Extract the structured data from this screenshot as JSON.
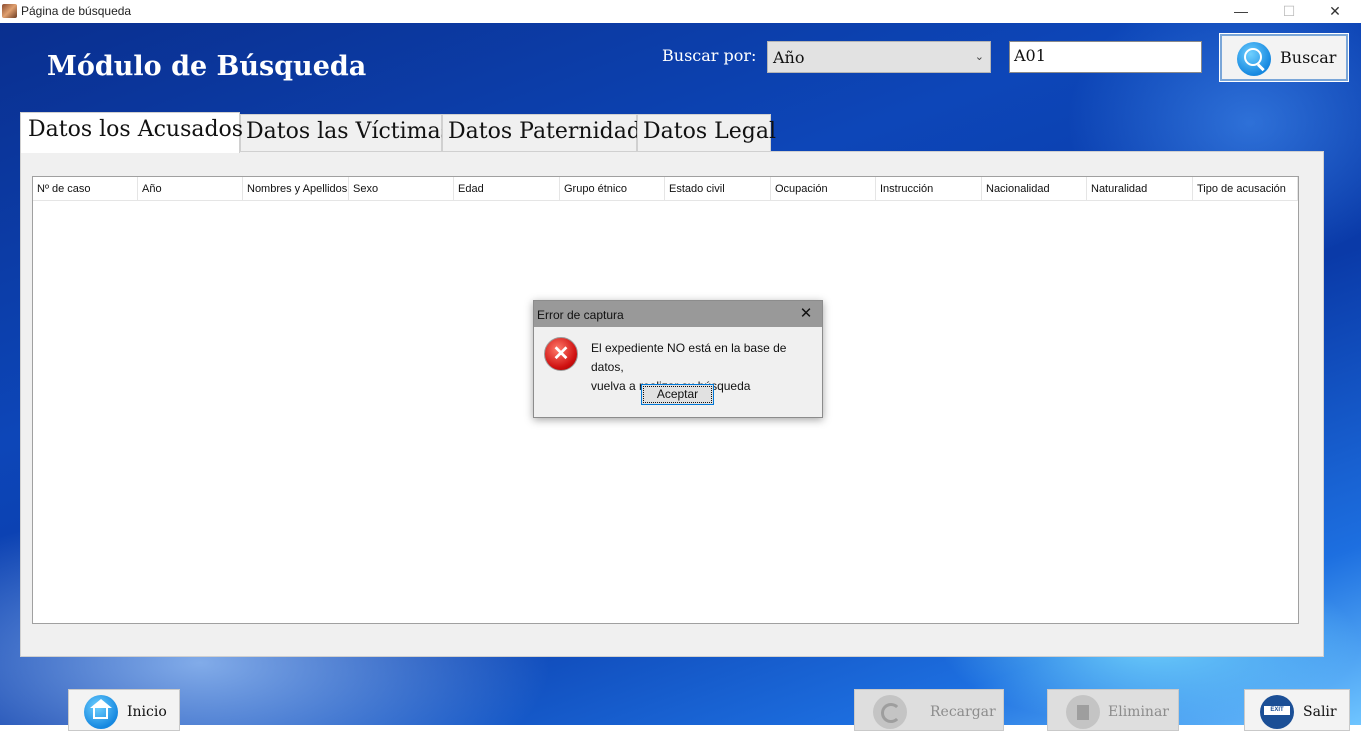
{
  "window": {
    "title": "Página de búsqueda",
    "controls": {
      "minimize": "—",
      "maximize": "☐",
      "close": "✕"
    }
  },
  "header": {
    "module_title": "Módulo de Búsqueda",
    "search_label": "Buscar por:",
    "search_field": {
      "selected": "Año"
    },
    "search_value": "A01",
    "search_button": "Buscar"
  },
  "tabs": [
    {
      "label": "Datos los Acusados",
      "active": true
    },
    {
      "label": "Datos las Víctimas",
      "active": false
    },
    {
      "label": "Datos Paternidad",
      "active": false
    },
    {
      "label": "Datos Legal",
      "active": false
    }
  ],
  "table": {
    "columns": [
      "Nº de caso",
      "Año",
      "Nombres y Apellidos",
      "Sexo",
      "Edad",
      "Grupo étnico",
      "Estado civil",
      "Ocupación",
      "Instrucción",
      "Nacionalidad",
      "Naturalidad",
      "Tipo de acusación"
    ],
    "rows": []
  },
  "dialog": {
    "title": "Error de captura",
    "message_line1": "El expediente NO está en la base de datos,",
    "message_line2": "vuelva a realizar su búsqueda",
    "ok_button": "Aceptar",
    "icon": "error-icon"
  },
  "bottom_buttons": {
    "inicio": "Inicio",
    "recargar": "Recargar",
    "eliminar": "Eliminar",
    "salir": "Salir",
    "exit_badge": "EXIT"
  },
  "colors": {
    "accent": "#1688e0",
    "background": "#0d46b8",
    "error": "#cf1010"
  }
}
